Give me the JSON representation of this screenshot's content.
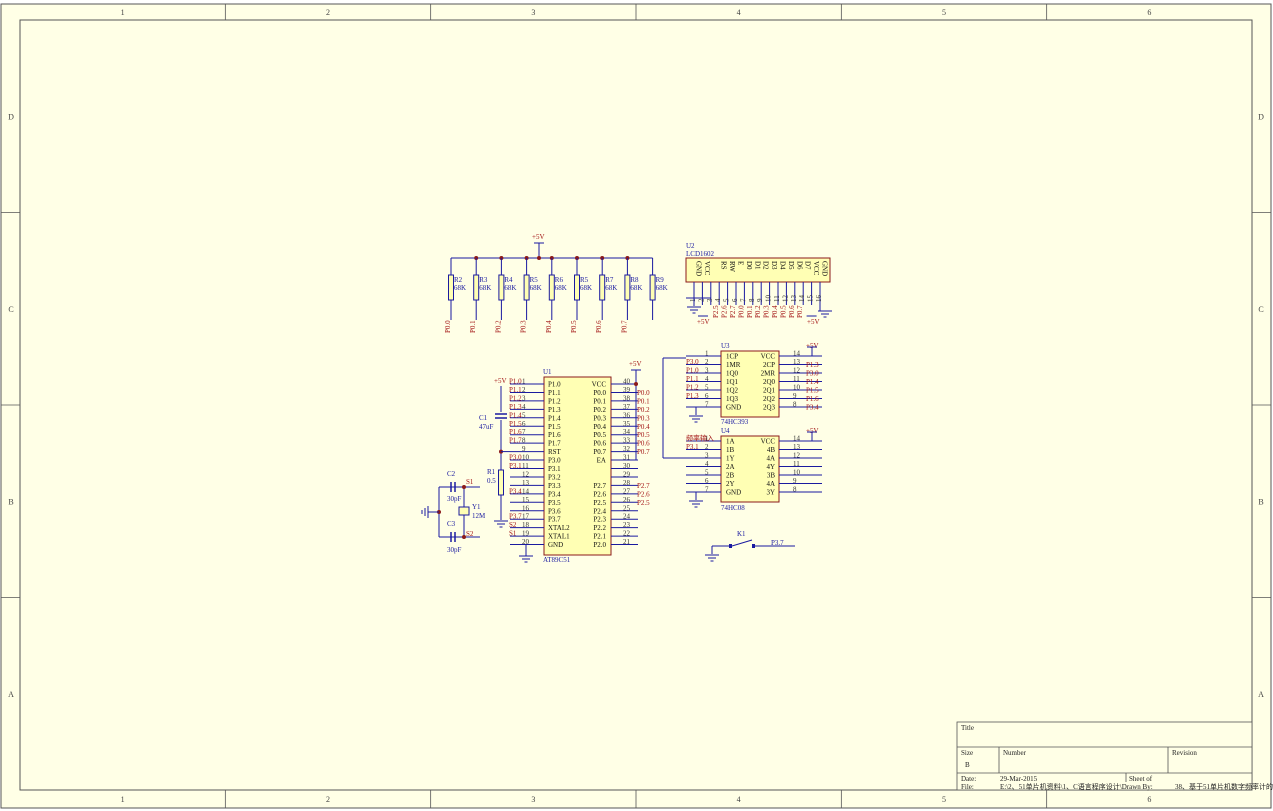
{
  "border": {
    "columns": [
      "1",
      "2",
      "3",
      "4",
      "5",
      "6"
    ],
    "rows": [
      "D",
      "C",
      "B",
      "A"
    ]
  },
  "colors": {
    "sheet_bg": "#ffffe6",
    "part_fill": "#ffffb4",
    "part_stroke": "#8b1a1a",
    "wire": "#1a1aa0",
    "net_label": "#a31515",
    "junction": "#8b1a1a"
  },
  "power": {
    "vcc_label": "+5V",
    "lcd_vcc_label": "+5V",
    "lcd_v0_label": "+5V",
    "u1_vcc_label": "+5V",
    "u1_reset_label": "+5V",
    "u3_vcc_label": "+5V",
    "u4_vcc_label": "+5V"
  },
  "resistor_array": {
    "resistors": [
      {
        "ref": "R2",
        "value": "68K",
        "net": "P0.0"
      },
      {
        "ref": "R3",
        "value": "68K",
        "net": "P0.1"
      },
      {
        "ref": "R4",
        "value": "68K",
        "net": "P0.2"
      },
      {
        "ref": "R5",
        "value": "68K",
        "net": "P0.3"
      },
      {
        "ref": "R6",
        "value": "68K",
        "net": "P0.4"
      },
      {
        "ref": "R5",
        "value": "68K",
        "net": "P0.5"
      },
      {
        "ref": "R7",
        "value": "68K",
        "net": "P0.6"
      },
      {
        "ref": "R8",
        "value": "68K",
        "net": "P0.7"
      },
      {
        "ref": "R9",
        "value": "68K",
        "net": ""
      }
    ]
  },
  "u2": {
    "ref": "U2",
    "part": "LCD1602",
    "pins": [
      {
        "name": "GND",
        "num": "1",
        "net": ""
      },
      {
        "name": "VCC",
        "num": "2",
        "net": ""
      },
      {
        "name": "",
        "num": "3",
        "net": ""
      },
      {
        "name": "RS",
        "num": "4",
        "net": "P2.5"
      },
      {
        "name": "RW",
        "num": "5",
        "net": "P2.6"
      },
      {
        "name": "E",
        "num": "6",
        "net": "P2.7"
      },
      {
        "name": "D0",
        "num": "7",
        "net": "P0.0"
      },
      {
        "name": "D1",
        "num": "8",
        "net": "P0.1"
      },
      {
        "name": "D2",
        "num": "9",
        "net": "P0.2"
      },
      {
        "name": "D3",
        "num": "10",
        "net": "P0.3"
      },
      {
        "name": "D4",
        "num": "11",
        "net": "P0.4"
      },
      {
        "name": "D5",
        "num": "12",
        "net": "P0.5"
      },
      {
        "name": "D6",
        "num": "13",
        "net": "P0.6"
      },
      {
        "name": "D7",
        "num": "14",
        "net": "P0.7"
      },
      {
        "name": "VCC",
        "num": "15",
        "net": ""
      },
      {
        "name": "GND",
        "num": "16",
        "net": ""
      }
    ]
  },
  "u1": {
    "ref": "U1",
    "part": "AT89C51",
    "left_pins": [
      {
        "name": "P1.0",
        "num": "1",
        "net": "P1.0"
      },
      {
        "name": "P1.1",
        "num": "2",
        "net": "P1.1"
      },
      {
        "name": "P1.2",
        "num": "3",
        "net": "P1.2"
      },
      {
        "name": "P1.3",
        "num": "4",
        "net": "P1.3"
      },
      {
        "name": "P1.4",
        "num": "5",
        "net": "P1.4"
      },
      {
        "name": "P1.5",
        "num": "6",
        "net": "P1.5"
      },
      {
        "name": "P1.6",
        "num": "7",
        "net": "P1.6"
      },
      {
        "name": "P1.7",
        "num": "8",
        "net": "P1.7"
      },
      {
        "name": "RST",
        "num": "9",
        "net": ""
      },
      {
        "name": "P3.0",
        "num": "10",
        "net": "P3.0"
      },
      {
        "name": "P3.1",
        "num": "11",
        "net": "P3.1"
      },
      {
        "name": "P3.2",
        "num": "12",
        "net": ""
      },
      {
        "name": "P3.3",
        "num": "13",
        "net": ""
      },
      {
        "name": "P3.4",
        "num": "14",
        "net": "P3.4"
      },
      {
        "name": "P3.5",
        "num": "15",
        "net": ""
      },
      {
        "name": "P3.6",
        "num": "16",
        "net": ""
      },
      {
        "name": "P3.7",
        "num": "17",
        "net": "P3.7"
      },
      {
        "name": "XTAL2",
        "num": "18",
        "net": "S2"
      },
      {
        "name": "XTAL1",
        "num": "19",
        "net": "S1"
      },
      {
        "name": "GND",
        "num": "20",
        "net": ""
      }
    ],
    "right_pins": [
      {
        "name": "VCC",
        "num": "40",
        "net": ""
      },
      {
        "name": "P0.0",
        "num": "39",
        "net": "P0.0"
      },
      {
        "name": "P0.1",
        "num": "38",
        "net": "P0.1"
      },
      {
        "name": "P0.2",
        "num": "37",
        "net": "P0.2"
      },
      {
        "name": "P0.3",
        "num": "36",
        "net": "P0.3"
      },
      {
        "name": "P0.4",
        "num": "35",
        "net": "P0.4"
      },
      {
        "name": "P0.5",
        "num": "34",
        "net": "P0.5"
      },
      {
        "name": "P0.6",
        "num": "33",
        "net": "P0.6"
      },
      {
        "name": "P0.7",
        "num": "32",
        "net": "P0.7"
      },
      {
        "name": "EA",
        "num": "31",
        "net": ""
      },
      {
        "name": "",
        "num": "30",
        "net": ""
      },
      {
        "name": "",
        "num": "29",
        "net": ""
      },
      {
        "name": "P2.7",
        "num": "28",
        "net": "P2.7"
      },
      {
        "name": "P2.6",
        "num": "27",
        "net": "P2.6"
      },
      {
        "name": "P2.5",
        "num": "26",
        "net": "P2.5"
      },
      {
        "name": "P2.4",
        "num": "25",
        "net": ""
      },
      {
        "name": "P2.3",
        "num": "24",
        "net": ""
      },
      {
        "name": "P2.2",
        "num": "23",
        "net": ""
      },
      {
        "name": "P2.1",
        "num": "22",
        "net": ""
      },
      {
        "name": "P2.0",
        "num": "21",
        "net": ""
      }
    ]
  },
  "u3": {
    "ref": "U3",
    "part": "74HC393",
    "left_pins": [
      {
        "name": "1CP",
        "num": "1",
        "net": ""
      },
      {
        "name": "1MR",
        "num": "2",
        "net": "P3.0"
      },
      {
        "name": "1Q0",
        "num": "3",
        "net": "P1.0"
      },
      {
        "name": "1Q1",
        "num": "4",
        "net": "P1.1"
      },
      {
        "name": "1Q2",
        "num": "5",
        "net": "P1.2"
      },
      {
        "name": "1Q3",
        "num": "6",
        "net": "P1.3"
      },
      {
        "name": "GND",
        "num": "7",
        "net": ""
      }
    ],
    "right_pins": [
      {
        "name": "VCC",
        "num": "14",
        "net": ""
      },
      {
        "name": "2CP",
        "num": "13",
        "net": "P1.3"
      },
      {
        "name": "2MR",
        "num": "12",
        "net": "P3.0"
      },
      {
        "name": "2Q0",
        "num": "11",
        "net": "P1.4"
      },
      {
        "name": "2Q1",
        "num": "10",
        "net": "P1.5"
      },
      {
        "name": "2Q2",
        "num": "9",
        "net": "P1.6"
      },
      {
        "name": "2Q3",
        "num": "8",
        "net": "P3.4"
      }
    ]
  },
  "u4": {
    "ref": "U4",
    "part": "74HC08",
    "left_pins": [
      {
        "name": "1A",
        "num": "1",
        "net": "频率输入"
      },
      {
        "name": "1B",
        "num": "2",
        "net": "P3.1"
      },
      {
        "name": "1Y",
        "num": "3",
        "net": ""
      },
      {
        "name": "2A",
        "num": "4",
        "net": ""
      },
      {
        "name": "2B",
        "num": "5",
        "net": ""
      },
      {
        "name": "2Y",
        "num": "6",
        "net": ""
      },
      {
        "name": "GND",
        "num": "7",
        "net": ""
      }
    ],
    "right_pins": [
      {
        "name": "VCC",
        "num": "14",
        "net": ""
      },
      {
        "name": "4B",
        "num": "13",
        "net": ""
      },
      {
        "name": "4A",
        "num": "12",
        "net": ""
      },
      {
        "name": "4Y",
        "num": "11",
        "net": ""
      },
      {
        "name": "3B",
        "num": "10",
        "net": ""
      },
      {
        "name": "4A",
        "num": "9",
        "net": ""
      },
      {
        "name": "3Y",
        "num": "8",
        "net": ""
      }
    ]
  },
  "passives": {
    "c1_ref": "C1",
    "c1_value": "47uF",
    "r1_ref": "R1",
    "r1_value": "0.5",
    "c2_ref": "C2",
    "c2_value": "30pF",
    "c3_ref": "C3",
    "c3_value": "30pF",
    "y1_ref": "Y1",
    "y1_value": "12M",
    "s1_net": "S1",
    "s2_net": "S2",
    "k1_ref": "K1",
    "k1_net": "P3.7"
  },
  "title_block": {
    "title_label": "Title",
    "size_label": "Size",
    "size_value": "B",
    "number_label": "Number",
    "revision_label": "Revision",
    "date_label": "Date:",
    "date_value": "29-Mar-2015",
    "sheet_label": "Sheet    of",
    "file_label": "File:",
    "file_value": "E:\\2、51单片机资料\\1、C语言程序设计\\Drawn By:",
    "drawn_by_value": "38、基于51单片机数字频率计的"
  }
}
